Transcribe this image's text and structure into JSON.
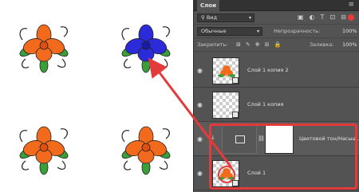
{
  "panel": {
    "title": "Слои",
    "kind_filter": "Вид",
    "blend_mode": "Обычные",
    "opacity_label": "Непрозрачность:",
    "opacity_value": "100%",
    "lock_label": "Закрепить:",
    "fill_label": "Заливка:",
    "fill_value": "100%"
  },
  "layers": [
    {
      "name": "Слой 1 копия 2"
    },
    {
      "name": "Слой 1 копия"
    },
    {
      "name": "Цветовой тон/Насыщ..."
    },
    {
      "name": "Слой 1"
    }
  ],
  "colors": {
    "accent_red": "#e33b3b",
    "flower_orange": "#f26a1b",
    "flower_blue": "#2b2bd9",
    "leaf_green": "#3a9e3a"
  }
}
